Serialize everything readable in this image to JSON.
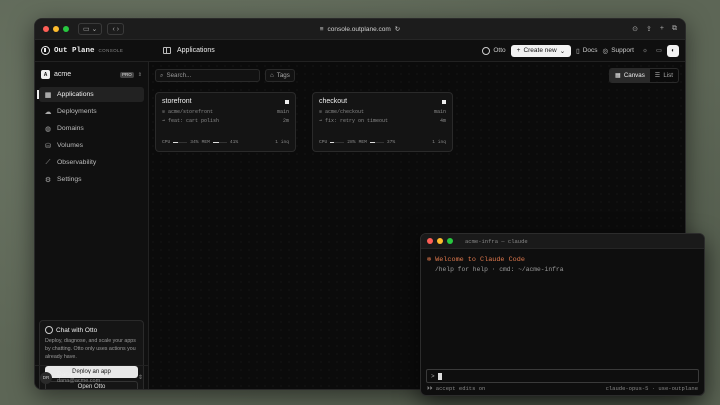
{
  "browser": {
    "url": "console.outplane.com",
    "nav_back": "‹",
    "nav_forward": "›"
  },
  "app": {
    "logo_text": "Out Plane",
    "logo_sub": "CONSOLE",
    "page_title": "Applications",
    "otto_label": "Otto",
    "create_label": "Create new",
    "docs_label": "Docs",
    "support_label": "Support"
  },
  "sidebar": {
    "org_initial": "A",
    "org_name": "acme",
    "org_badge": "PRO",
    "items": [
      {
        "label": "Applications",
        "icon": "grid-icon"
      },
      {
        "label": "Deployments",
        "icon": "cloud-icon"
      },
      {
        "label": "Domains",
        "icon": "globe-icon"
      },
      {
        "label": "Volumes",
        "icon": "database-icon"
      },
      {
        "label": "Observability",
        "icon": "chart-icon"
      },
      {
        "label": "Settings",
        "icon": "gear-icon"
      }
    ],
    "otto_card": {
      "title": "Chat with Otto",
      "desc": "Deploy, diagnose, and scale your apps by chatting. Otto only uses actions you already have.",
      "deploy_label": "Deploy an app",
      "open_label": "Open Otto"
    },
    "user": {
      "initials": "DR",
      "name": "Dana Reyes",
      "email": "dana@acme.com"
    }
  },
  "toolbar": {
    "search_placeholder": "Search...",
    "tags_label": "Tags",
    "canvas_label": "Canvas",
    "list_label": "List"
  },
  "apps": [
    {
      "name": "storefront",
      "repo": "acme/storefront",
      "branch": "main",
      "commit": "feat: cart polish",
      "age": "2m",
      "cpu_label": "CPU",
      "cpu_value": "34%",
      "cpu_pct": 0.34,
      "mem_label": "MEM",
      "mem_value": "41%",
      "mem_pct": 0.41,
      "instances": "1 inq"
    },
    {
      "name": "checkout",
      "repo": "acme/checkout",
      "branch": "main",
      "commit": "fix: retry on timeout",
      "age": "4m",
      "cpu_label": "CPU",
      "cpu_value": "28%",
      "cpu_pct": 0.28,
      "mem_label": "MEM",
      "mem_value": "37%",
      "mem_pct": 0.37,
      "instances": "1 inq"
    }
  ],
  "terminal": {
    "title": "acme-infra — claude",
    "welcome": "✻ Welcome to Claude Code",
    "help": "/help for help · cmd: ~/acme-infra",
    "prompt": ">",
    "status_left": "⏵⏵ accept edits on",
    "status_right": "claude-opus-5 · use-outplane"
  }
}
